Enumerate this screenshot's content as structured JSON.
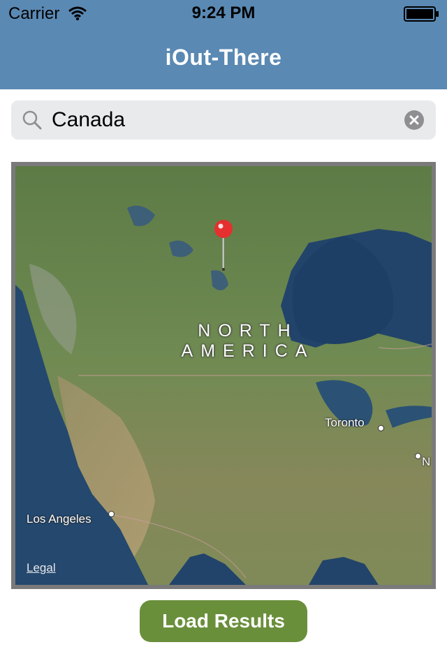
{
  "status_bar": {
    "carrier": "Carrier",
    "time": "9:24 PM"
  },
  "nav": {
    "title": "iOut-There",
    "background_color": "#5a89b3"
  },
  "search": {
    "value": "Canada",
    "icons": {
      "search": "search-icon",
      "clear": "clear-icon"
    }
  },
  "map": {
    "region_label_line1": "NORTH",
    "region_label_line2": "AMERICA",
    "cities": [
      {
        "name": "Toronto"
      },
      {
        "name": "Los Angeles"
      },
      {
        "name": "N"
      }
    ],
    "legal": "Legal",
    "pin_icon": "map-pin-icon",
    "pin_color": "#e62f2f"
  },
  "actions": {
    "load_results": "Load Results",
    "button_color": "#6a8f3b"
  }
}
